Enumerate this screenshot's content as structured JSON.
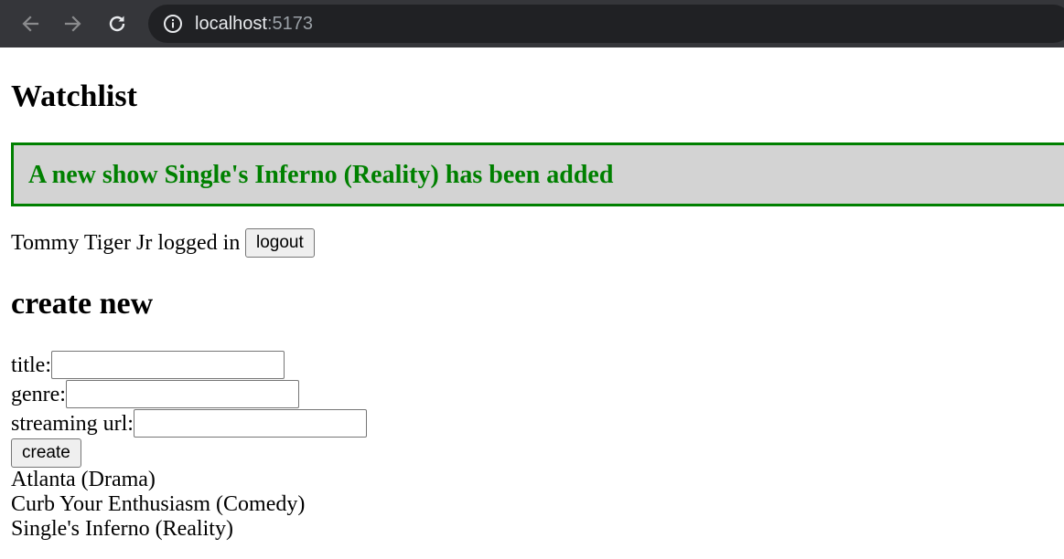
{
  "browser": {
    "url_host": "localhost",
    "url_port": ":5173",
    "icons": [
      "back-arrow-icon",
      "forward-arrow-icon",
      "reload-icon",
      "info-icon"
    ]
  },
  "page": {
    "title": "Watchlist",
    "notification": {
      "message": "A new show Single's Inferno (Reality) has been added",
      "color": "#008000",
      "background": "#d3d3d3"
    },
    "user": {
      "logged_in_text": "Tommy Tiger Jr logged in",
      "logout_label": "logout"
    },
    "create_form": {
      "heading": "create new",
      "title_label": "title:",
      "title_value": "",
      "genre_label": "genre:",
      "genre_value": "",
      "url_label": "streaming url:",
      "url_value": "",
      "submit_label": "create"
    },
    "shows": [
      "Atlanta (Drama)",
      "Curb Your Enthusiasm (Comedy)",
      "Single's Inferno (Reality)"
    ]
  }
}
